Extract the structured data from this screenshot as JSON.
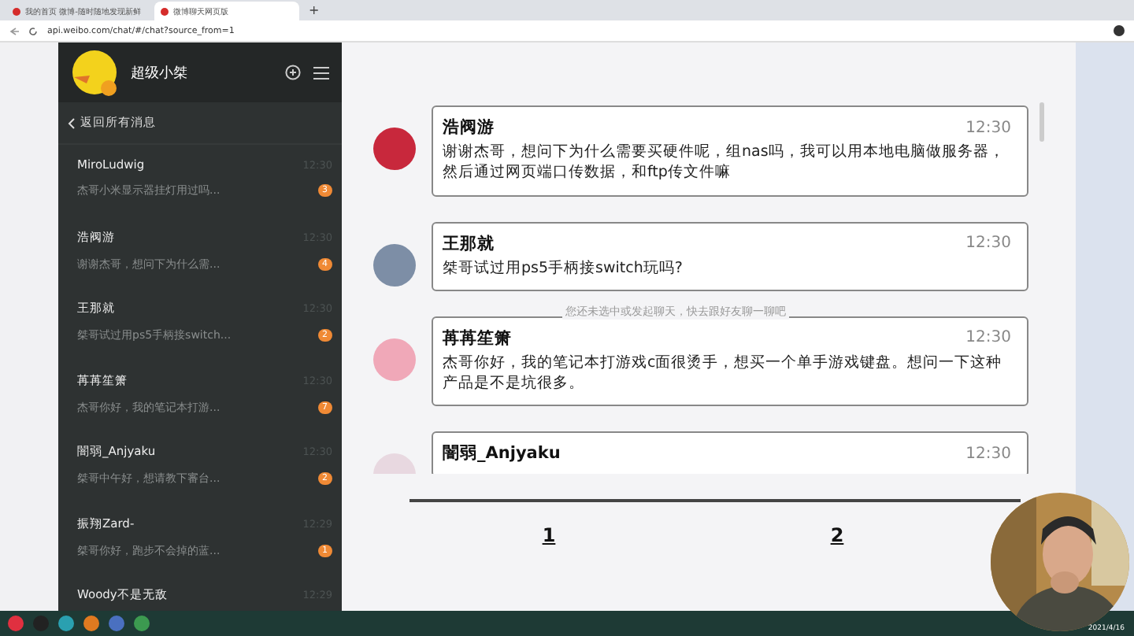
{
  "browser": {
    "tabs": [
      {
        "title": "我的首页 微博-随时随地发现新鲜",
        "selected": false
      },
      {
        "title": "微博聊天网页版",
        "selected": true
      }
    ],
    "new_tab": "+",
    "address": "api.weibo.com/chat/#/chat?source_from=1"
  },
  "sidebar": {
    "account": "超级小桀",
    "back_link": "返回所有消息",
    "conversations": [
      {
        "name": "MiroLudwig",
        "time": "12:30",
        "preview": "杰哥小米显示器挂灯用过吗...",
        "badge": "3"
      },
      {
        "name": "浩阀游",
        "time": "12:30",
        "preview": "谢谢杰哥，想问下为什么需...",
        "badge": "4"
      },
      {
        "name": "王那就",
        "time": "12:30",
        "preview": "桀哥试过用ps5手柄接switch...",
        "badge": "2"
      },
      {
        "name": "苒苒笙箫",
        "time": "12:30",
        "preview": "杰哥你好，我的笔记本打游...",
        "badge": "7"
      },
      {
        "name": "闇弱_Anjyaku",
        "time": "12:30",
        "preview": "桀哥中午好，想请教下審台...",
        "badge": "2"
      },
      {
        "name": "振翔Zard-",
        "time": "12:29",
        "preview": "桀哥你好，跑步不会掉的蓝...",
        "badge": "1"
      },
      {
        "name": "Woody不是无敌",
        "time": "12:29"
      }
    ]
  },
  "chat": {
    "empty_hint": "您还未选中或发起聊天，快去跟好友聊一聊吧",
    "messages": [
      {
        "name": "浩阀游",
        "time": "12:30",
        "text": "谢谢杰哥，想问下为什么需要买硬件呢，组nas吗，我可以用本地电脑做服务器，然后通过网页端口传数据，和ftp传文件嘛",
        "color": "#c8283c"
      },
      {
        "name": "王那就",
        "time": "12:30",
        "text": "桀哥试过用ps5手柄接switch玩吗?",
        "color": "#7d8ea6"
      },
      {
        "name": "苒苒笙箫",
        "time": "12:30",
        "text": "杰哥你好，我的笔记本打游戏c面很烫手，想买一个单手游戏键盘。想问一下这种产品是不是坑很多。",
        "color": "#f0a8b8"
      },
      {
        "name": "闇弱_Anjyaku",
        "time": "12:30",
        "color": "#e8d8e0"
      }
    ],
    "pages": [
      {
        "label": "1"
      },
      {
        "label": "2"
      }
    ]
  },
  "taskbar": {
    "date": "2021/4/16"
  }
}
